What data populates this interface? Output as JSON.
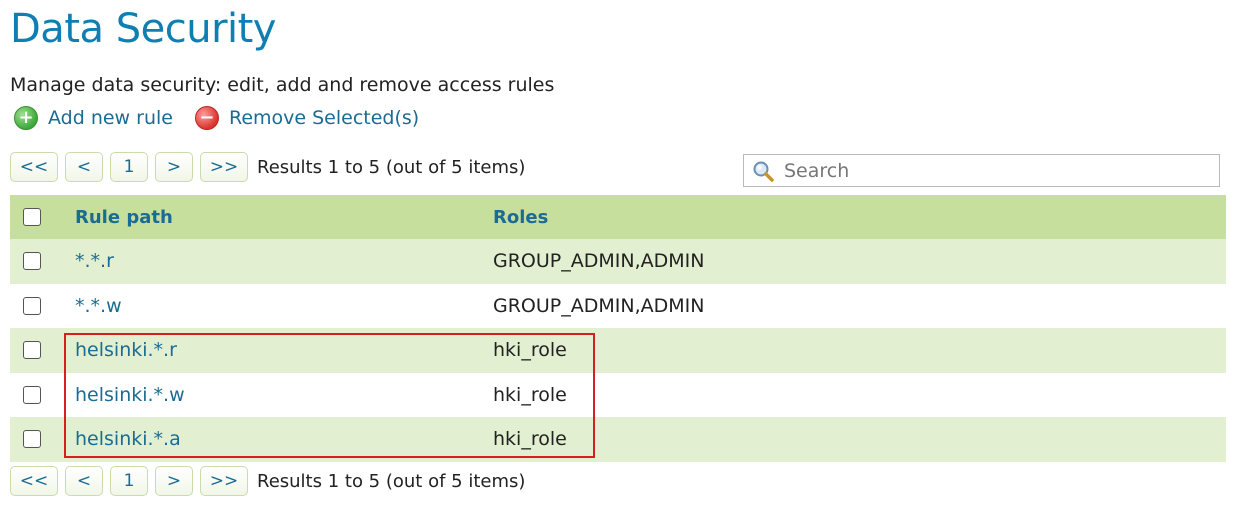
{
  "page": {
    "title": "Data Security",
    "subtitle": "Manage data security: edit, add and remove access rules"
  },
  "actions": {
    "add_label": "Add new rule",
    "remove_label": "Remove Selected(s)"
  },
  "pager": {
    "first": "<<",
    "prev": "<",
    "page": "1",
    "next": ">",
    "last": ">>",
    "info": "Results 1 to 5 (out of 5 items)"
  },
  "search": {
    "placeholder": "Search"
  },
  "table": {
    "headers": {
      "path": "Rule path",
      "roles": "Roles"
    },
    "rows": [
      {
        "path": "*.*.r",
        "roles": "GROUP_ADMIN,ADMIN"
      },
      {
        "path": "*.*.w",
        "roles": "GROUP_ADMIN,ADMIN"
      },
      {
        "path": "helsinki.*.r",
        "roles": "hki_role"
      },
      {
        "path": "helsinki.*.w",
        "roles": "hki_role"
      },
      {
        "path": "helsinki.*.a",
        "roles": "hki_role"
      }
    ]
  },
  "colors": {
    "title": "#0e7fb3",
    "link": "#1a6c94",
    "header_bg": "#c6df9c",
    "row_alt_bg": "#e3efd1",
    "highlight_border": "#d62020"
  },
  "icons": {
    "add": "add-icon",
    "remove": "remove-icon",
    "search": "search-icon"
  }
}
